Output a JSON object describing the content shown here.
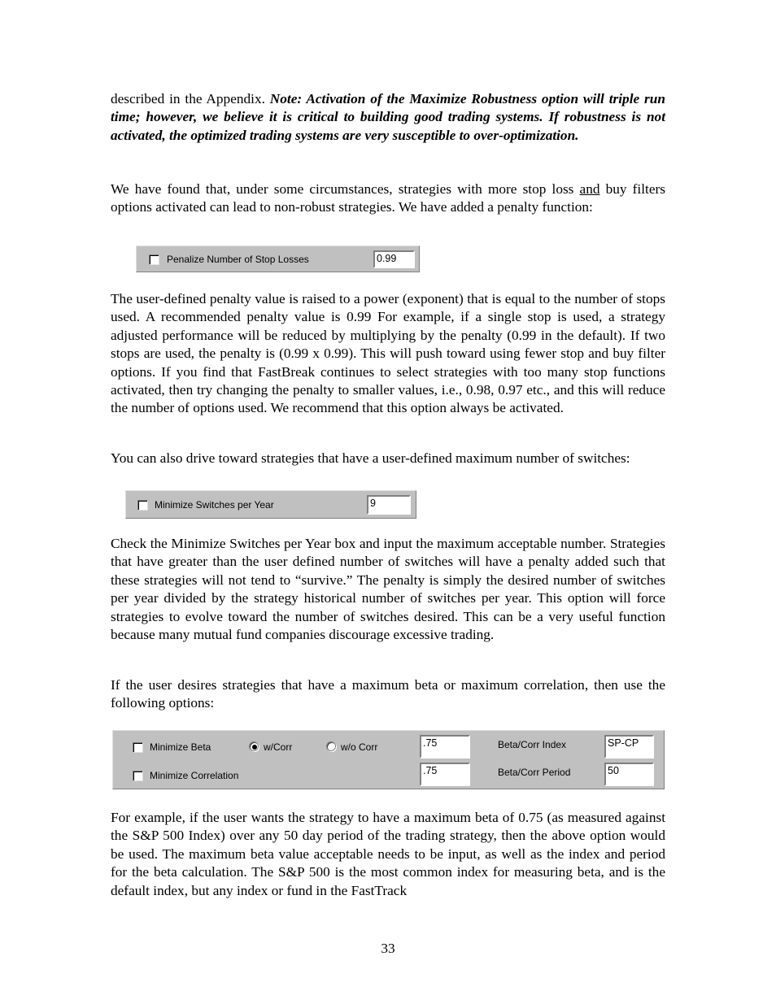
{
  "document": {
    "page_number": "33",
    "paragraphs": {
      "p1_lead": "described in the Appendix.  ",
      "p1_emphasis": "Note:  Activation of the Maximize Robustness option will triple run time; however, we believe it is critical to building good trading systems.  If robustness is not activated, the optimized trading systems are very susceptible to over-optimization.",
      "p2_part1": "We have found that, under some circumstances, strategies with more stop loss ",
      "p2_underlined": "and",
      "p2_part2": " buy filters options activated can lead to non-robust strategies.  We have added a penalty function:",
      "p3": "The user-defined penalty value is raised to a power (exponent) that is equal to the number of stops used.  A recommended penalty value is 0.99   For example, if a single stop is used, a strategy adjusted performance will be reduced by multiplying by the penalty (0.99 in the default).  If two stops are used, the penalty is (0.99 x 0.99).  This will push toward using fewer stop and buy filter options.  If you find that FastBreak continues to select strategies with too many stop functions activated, then try changing the penalty to smaller values, i.e.,  0.98, 0.97 etc., and this will reduce the number of options used.  We recommend that this option always be activated.",
      "p4": "You can also drive toward strategies that have a user-defined maximum number of switches:",
      "p5": "Check the Minimize Switches per Year box and input the maximum acceptable number.  Strategies that have greater than the user defined number of switches will have a penalty added such that these strategies will not tend to “survive.”  The penalty is simply the desired number of switches per year divided by the strategy historical number of switches per year.   This option will force strategies to evolve toward the number of switches desired.  This can be a very useful function because many mutual fund companies discourage excessive trading.",
      "p6": "If the user desires strategies that have a maximum beta or maximum correlation, then use the following options:",
      "p7": "For example, if the user wants the strategy to have a maximum beta of 0.75 (as measured against the S&P 500 Index) over any 50 day period of the trading strategy, then the above option would be used.  The maximum beta value acceptable needs to be input, as well as the index and period for the beta calculation.  The S&P 500 is the most common index for measuring beta, and is the default index, but any index or fund in the FastTrack"
    }
  },
  "widgets": {
    "penalize_stop_losses": {
      "checkbox_label": "Penalize Number of Stop Losses",
      "checked": false,
      "value": "0.99"
    },
    "minimize_switches": {
      "checkbox_label": "Minimize Switches per Year",
      "checked": false,
      "value": "9"
    },
    "beta_correlation": {
      "minimize_beta_label": "Minimize Beta",
      "minimize_beta_checked": false,
      "minimize_correlation_label": "Minimize Correlation",
      "minimize_correlation_checked": false,
      "radio_with_corr_label": "w/Corr",
      "radio_with_corr_selected": true,
      "radio_without_corr_label": "w/o Corr",
      "radio_without_corr_selected": false,
      "beta_value": ".75",
      "correlation_value": ".75",
      "beta_corr_index_label": "Beta/Corr Index",
      "beta_corr_index_value": "SP-CP",
      "beta_corr_period_label": "Beta/Corr Period",
      "beta_corr_period_value": "50"
    }
  },
  "colors": {
    "panel_face": "#c0c0c0",
    "panel_shadow": "#808080",
    "panel_highlight": "#dfdfdf",
    "field_background": "#ffffff",
    "text": "#000000"
  }
}
